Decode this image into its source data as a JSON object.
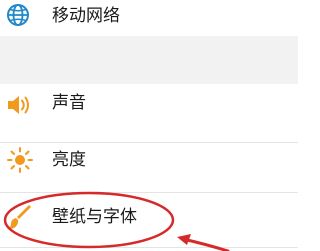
{
  "settings": {
    "items": [
      {
        "label": "移动网络",
        "icon": "globe-icon"
      },
      {
        "label": "声音",
        "icon": "speaker-icon"
      },
      {
        "label": "亮度",
        "icon": "sun-icon"
      },
      {
        "label": "壁纸与字体",
        "icon": "paintbrush-icon"
      }
    ]
  },
  "colors": {
    "network_icon": "#1e88c8",
    "sound_icon": "#f29a1d",
    "brightness_icon": "#f29a1d",
    "wallpaper_icon": "#f29a1d",
    "annotation": "#d62a2a",
    "divider": "#e4e4e4",
    "section_gap": "#f2f2f2"
  }
}
